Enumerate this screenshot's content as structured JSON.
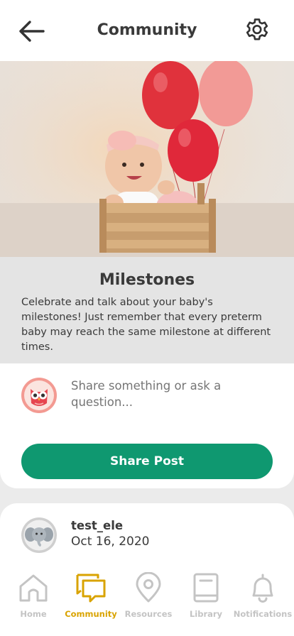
{
  "header": {
    "title": "Community"
  },
  "topic": {
    "title": "Milestones",
    "description": "Celebrate and talk about your baby's milestones! Just remember that every preterm baby may reach the same milestone at different times."
  },
  "composer": {
    "placeholder": "Share something or ask a question...",
    "value": "",
    "share_label": "Share Post"
  },
  "post": {
    "username": "test_ele",
    "date": "Oct 16, 2020"
  },
  "tabs": [
    {
      "label": "Home",
      "icon": "home-icon",
      "active": false
    },
    {
      "label": "Community",
      "icon": "chat-icon",
      "active": true
    },
    {
      "label": "Resources",
      "icon": "map-pin-icon",
      "active": false
    },
    {
      "label": "Library",
      "icon": "book-icon",
      "active": false
    },
    {
      "label": "Notifications",
      "icon": "bell-icon",
      "active": false
    }
  ],
  "colors": {
    "accent": "#0f9870",
    "active_tab": "#d9a300",
    "inactive_tab": "#c4c4c4"
  }
}
